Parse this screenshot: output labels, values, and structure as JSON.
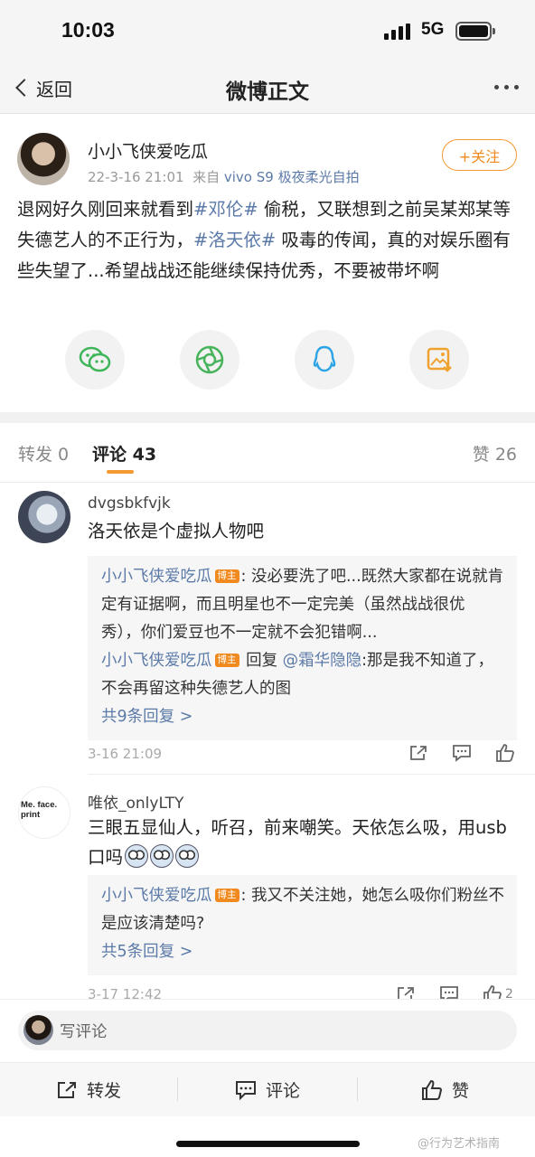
{
  "status": {
    "time": "10:03",
    "network": "5G"
  },
  "nav": {
    "back_label": "返回",
    "title": "微博正文"
  },
  "post": {
    "username": "小小飞侠爱吃瓜",
    "date": "22-3-16 21:01",
    "source_prefix": "来自",
    "source": "vivo S9 极夜柔光自拍",
    "follow_label": "+关注",
    "text": {
      "p1": "退网好久刚回来就看到",
      "tag1": "#邓伦#",
      "p2": " 偷税，又联想到之前吴某郑某等失德艺人的不正行为，",
      "tag2": "#洛天依#",
      "p3": " 吸毒的传闻，真的对娱乐圈有些失望了...希望战战还能继续保持优秀，不要被带坏啊"
    },
    "share_icons": [
      "wechat-icon",
      "moments-icon",
      "qq-icon",
      "save-image-icon"
    ]
  },
  "tabs": {
    "repost": "转发 0",
    "comments": "评论 43",
    "likes": "赞 26"
  },
  "comments": [
    {
      "name": "dvgsbkfvjk",
      "text": "洛天依是个虚拟人物吧",
      "replies": [
        {
          "author": "小小飞侠爱吃瓜",
          "badge": "博主",
          "sep": ": ",
          "text": "没必要洗了吧...既然大家都在说就肯定有证据啊，而且明星也不一定完美（虽然战战很优秀），你们爱豆也不一定就不会犯错啊..."
        },
        {
          "author": "小小飞侠爱吃瓜",
          "badge": "博主",
          "mid": " 回复 ",
          "target": "@霜华隐隐",
          "sep": ":",
          "text": "那是我不知道了，不会再留这种失德艺人的图"
        }
      ],
      "more": "共9条回复 >",
      "time": "3-16 21:09"
    },
    {
      "name": "唯依_onlyLTY",
      "avatar_text": "Me. face. print",
      "text": "三眼五显仙人，听召，前来嘲笑。天依怎么吸，用usb口吗",
      "replies": [
        {
          "author": "小小飞侠爱吃瓜",
          "badge": "博主",
          "sep": ": ",
          "text": "我又不关注她，她怎么吸你们粉丝不是应该清楚吗?"
        }
      ],
      "more": "共5条回复 >",
      "time": "3-17 12:42",
      "like_count": "2"
    }
  ],
  "input": {
    "placeholder": "写评论"
  },
  "bottom": {
    "repost": "转发",
    "comment": "评论",
    "like": "赞"
  },
  "watermark": "@行为艺术指南",
  "colors": {
    "accent": "#f39a33",
    "link": "#5b7aa8"
  }
}
